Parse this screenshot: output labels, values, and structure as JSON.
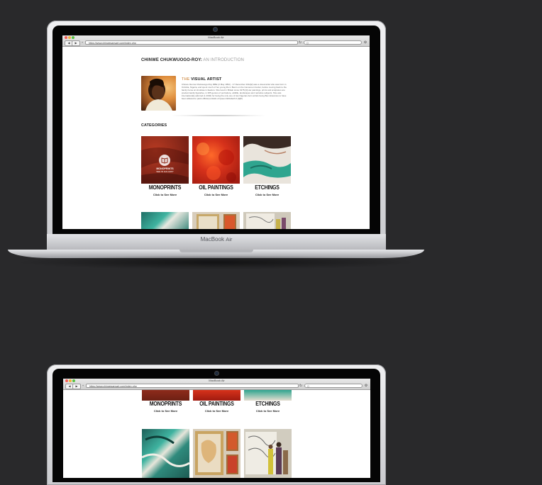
{
  "device": {
    "label_brand": "MacBook",
    "label_model": "Air"
  },
  "browser": {
    "window_title": "MacBook Air",
    "url": "https://www.chinwesanyart.com/index.php",
    "back": "◀",
    "forward": "▶",
    "plus": "+",
    "reload": "↻",
    "search_icon": "Q"
  },
  "page": {
    "artist_name": "CHINWE CHUKWUOGO-ROY:",
    "intro_suffix": " AN INTRODUCTION",
    "visual_prefix": "THE ",
    "visual_title": "VISUAL ARTIST",
    "bio": "Chinwe Ifeoma Chukwuogo-Roy MBE (2 May 1952) - 17 December 2012[2] was a visual artist who was born in Onitsha, Nigeria, and spent much of her young life in Benin on the Cameroon border, before moving back to the family home at Umuikwe in Ikeduru. She lived in Britain since 1975.[3] Her paintings, prints and sculptures are predominantly figurative, in 365 genres of portraiture, wildlife, landscapes and narrative subjects. She was internationally admired (1 2002) for being the only one of two Nigerian-born artists being Ben Enwonwu to have been allowed to paint official portraits of Queen Elizabeth II.[4][5]",
    "categories_heading": "CATEGORIES",
    "categories": [
      {
        "name": "MONOPRINTS",
        "sub": "Click to See More",
        "overlay_title": "MONOPRINTS",
        "overlay_sub": "SEE IN GALLERY"
      },
      {
        "name": "OIL PAINTINGS",
        "sub": "Click to See More"
      },
      {
        "name": "ETCHINGS",
        "sub": "Click to See More"
      }
    ]
  },
  "icons": {
    "book": "book-icon",
    "camera": "camera-icon"
  },
  "colors": {
    "background": "#29292b",
    "bezel": "#050505",
    "monoprints": "#8e2b1b",
    "oil": "#d7321b",
    "etchings": "#2fa58f"
  }
}
